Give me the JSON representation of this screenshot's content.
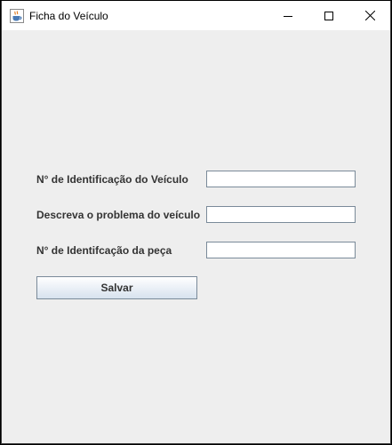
{
  "window": {
    "title": "Ficha do Veículo",
    "app_icon": "java-coffee-cup-icon",
    "controls": [
      "minimize-icon",
      "maximize-icon",
      "close-icon"
    ]
  },
  "form": {
    "fields": [
      {
        "label": "N° de Identificação do Veículo",
        "value": ""
      },
      {
        "label": "Descreva o problema do veículo",
        "value": ""
      },
      {
        "label": "N° de Identifcação da peça",
        "value": ""
      }
    ],
    "save_label": "Salvar"
  },
  "colors": {
    "background": "#eeeeee",
    "titlebar": "#ffffff",
    "label_text": "#333333",
    "field_border": "#7a8a99"
  }
}
